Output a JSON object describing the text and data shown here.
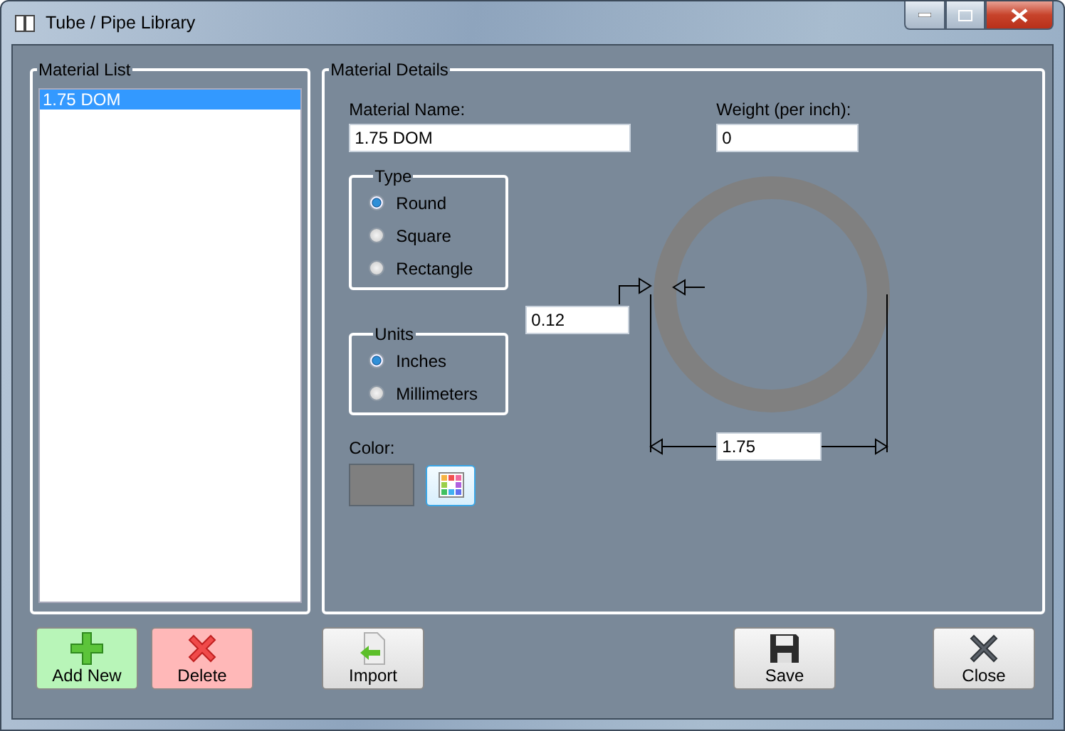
{
  "window": {
    "title": "Tube / Pipe  Library"
  },
  "material_list": {
    "title": "Material List",
    "items": [
      {
        "label": "1.75 DOM",
        "selected": true
      }
    ]
  },
  "material_details": {
    "title": "Material Details",
    "name": {
      "label": "Material Name:",
      "value": "1.75 DOM"
    },
    "weight": {
      "label": "Weight (per inch):",
      "value": "0"
    },
    "type": {
      "title": "Type",
      "options": [
        {
          "label": "Round",
          "selected": true
        },
        {
          "label": "Square",
          "selected": false
        },
        {
          "label": "Rectangle",
          "selected": false
        }
      ]
    },
    "units": {
      "title": "Units",
      "options": [
        {
          "label": "Inches",
          "selected": true
        },
        {
          "label": "Millimeters",
          "selected": false
        }
      ]
    },
    "color": {
      "label": "Color:"
    },
    "wall_thickness": "0.12",
    "diameter": "1.75"
  },
  "buttons": [
    {
      "kind": "add",
      "label": "Add New"
    },
    {
      "kind": "delete",
      "label": "Delete"
    },
    {
      "kind": "import",
      "label": "Import"
    },
    {
      "kind": "save",
      "label": "Save"
    },
    {
      "kind": "close",
      "label": "Close"
    }
  ]
}
